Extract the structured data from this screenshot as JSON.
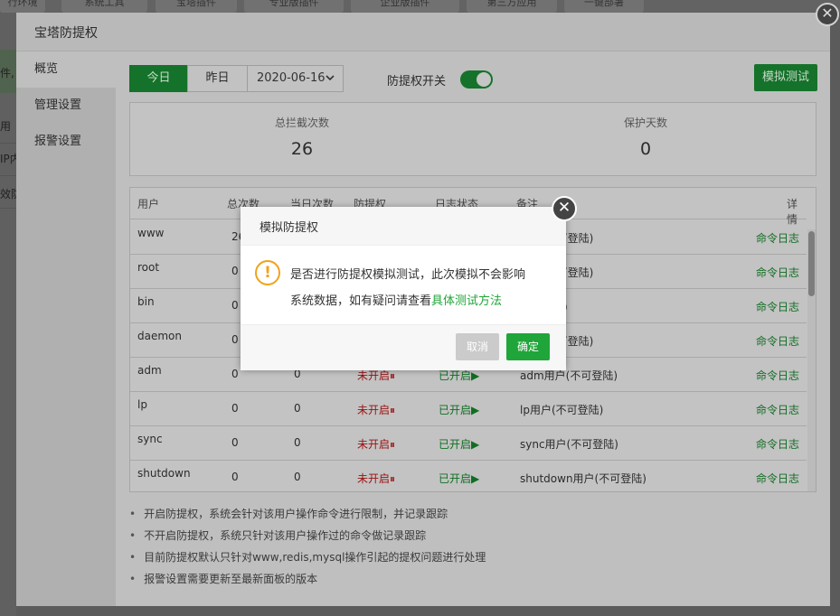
{
  "background_nav": {
    "tabs": [
      "行环境",
      "系统工具",
      "宝塔插件",
      "专业版插件",
      "企业版插件",
      "第三方应用",
      "一键部署"
    ],
    "left_fragments": [
      "件,",
      "用",
      "IP内",
      "效防"
    ]
  },
  "main_window": {
    "title": "宝塔防提权",
    "close_glyph": "✕",
    "sidebar": [
      {
        "label": "概览"
      },
      {
        "label": "管理设置"
      },
      {
        "label": "报警设置"
      }
    ]
  },
  "toolbar": {
    "today": "今日",
    "yesterday": "昨日",
    "date_value": "2020-06-16",
    "switch_label": "防提权开关",
    "switch_on": true,
    "simulate_button": "模拟测试"
  },
  "stats": {
    "total_label": "总拦截次数",
    "total_value": "26",
    "days_label": "保护天数",
    "days_value": "0"
  },
  "table": {
    "headers": [
      "用户",
      "总次数",
      "当日次数",
      "防提权",
      "日志状态",
      "备注",
      "详情"
    ],
    "rows": [
      {
        "user": "www",
        "total": "26",
        "today": "",
        "protect": "",
        "log": "",
        "note": "用户(不可登陆)",
        "detail": "命令日志"
      },
      {
        "user": "root",
        "total": "0",
        "today": "",
        "protect": "",
        "log": "",
        "note": "员用户(可登陆)",
        "detail": "命令日志"
      },
      {
        "user": "bin",
        "total": "0",
        "today": "",
        "protect": "",
        "log": "",
        "note": "不可登陆)",
        "detail": "命令日志"
      },
      {
        "user": "daemon",
        "total": "0",
        "today": "",
        "protect": "",
        "log": "",
        "note": "用户(不可登陆)",
        "detail": "命令日志"
      },
      {
        "user": "adm",
        "total": "0",
        "today": "0",
        "protect": "未开启⏸",
        "log": "已开启▶",
        "note": "adm用户(不可登陆)",
        "detail": "命令日志"
      },
      {
        "user": "lp",
        "total": "0",
        "today": "0",
        "protect": "未开启⏸",
        "log": "已开启▶",
        "note": "lp用户(不可登陆)",
        "detail": "命令日志"
      },
      {
        "user": "sync",
        "total": "0",
        "today": "0",
        "protect": "未开启⏸",
        "log": "已开启▶",
        "note": "sync用户(不可登陆)",
        "detail": "命令日志"
      },
      {
        "user": "shutdown",
        "total": "0",
        "today": "0",
        "protect": "未开启⏸",
        "log": "已开启▶",
        "note": "shutdown用户(不可登陆)",
        "detail": "命令日志"
      }
    ]
  },
  "tips": [
    "开启防提权，系统会针对该用户操作命令进行限制，并记录跟踪",
    "不开启防提权，系统只针对该用户操作过的命令做记录跟踪",
    "目前防提权默认只针对www,redis,mysql操作引起的提权问题进行处理",
    "报警设置需要更新至最新面板的版本"
  ],
  "dialog": {
    "title": "模拟防提权",
    "icon_glyph": "!",
    "message_line1": "是否进行防提权模拟测试，此次模拟不会影响",
    "message_line2": "系统数据，如有疑问请查看",
    "link_text": "具体测试方法",
    "cancel": "取消",
    "confirm": "确定",
    "close_glyph": "✕"
  }
}
